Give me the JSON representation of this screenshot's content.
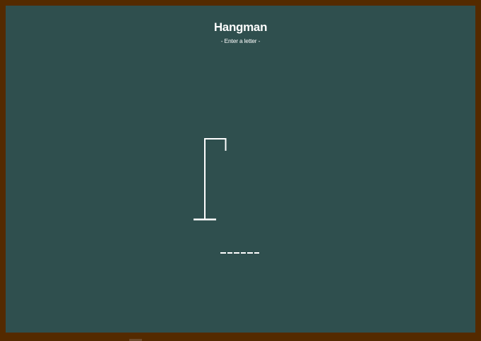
{
  "game": {
    "title": "Hangman",
    "prompt": "- Enter a letter -",
    "word_slots": 6,
    "wrong_guesses": 0
  },
  "colors": {
    "board": "#2f4f4e",
    "frame": "#542a00",
    "chalk": "#ffffff"
  }
}
